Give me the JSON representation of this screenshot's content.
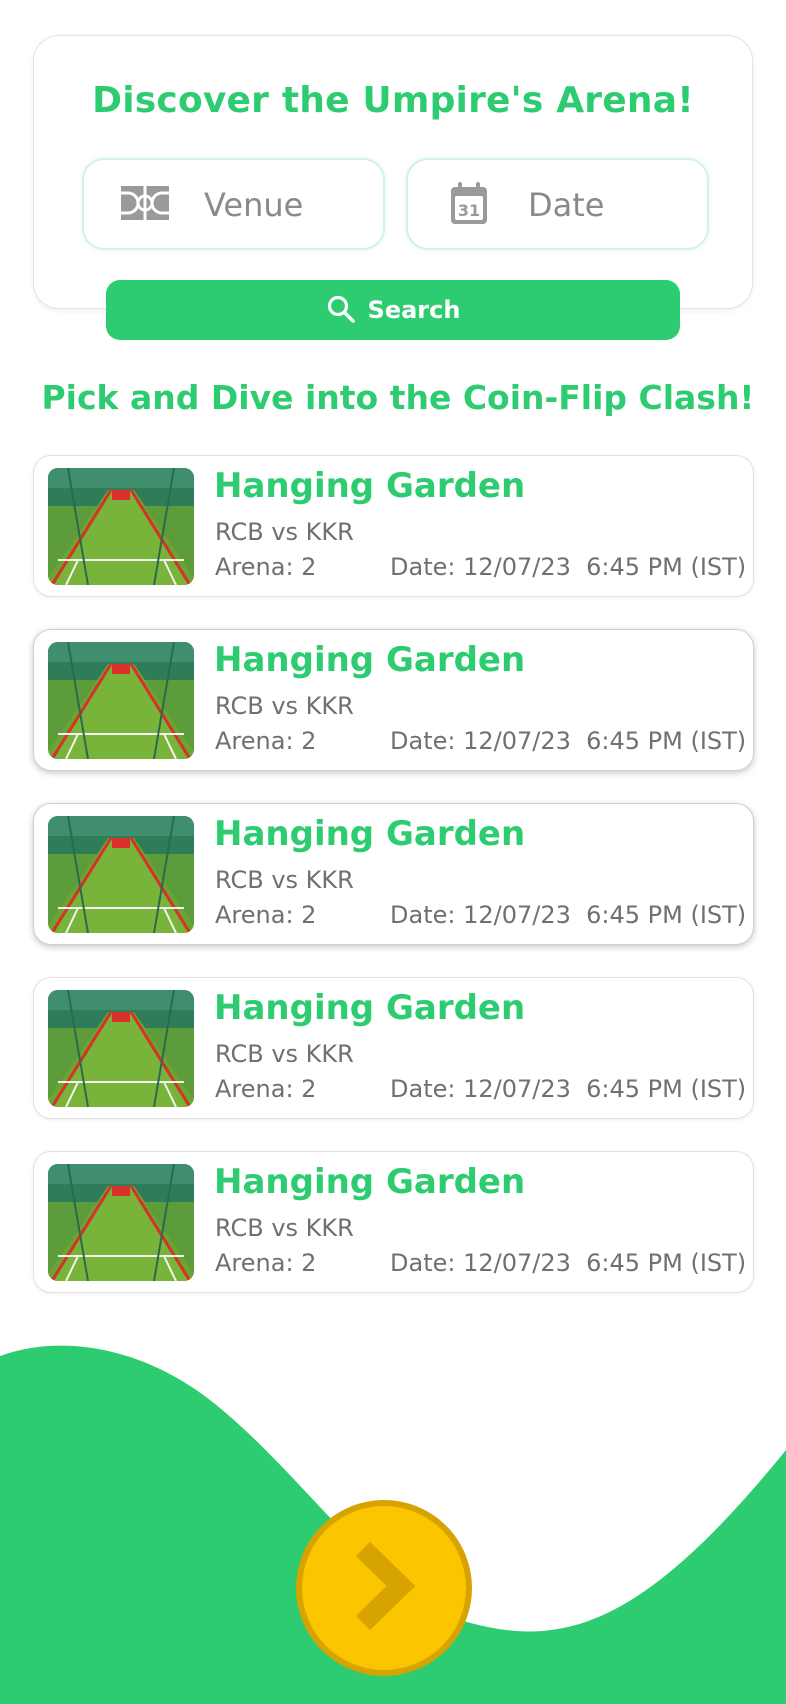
{
  "search": {
    "title": "Discover the Umpire's Arena!",
    "venue_placeholder": "Venue",
    "date_placeholder": "Date",
    "button_label": "Search"
  },
  "section": {
    "title": "Pick and Dive into the Coin-Flip Clash!"
  },
  "matches": [
    {
      "venue": "Hanging Garden",
      "teams": "RCB vs KKR",
      "arena": "Arena: 2",
      "datetime": "Date: 12/07/23  6:45 PM (IST)"
    },
    {
      "venue": "Hanging Garden",
      "teams": "RCB vs KKR",
      "arena": "Arena: 2",
      "datetime": "Date: 12/07/23  6:45 PM (IST)"
    },
    {
      "venue": "Hanging Garden",
      "teams": "RCB vs KKR",
      "arena": "Arena: 2",
      "datetime": "Date: 12/07/23  6:45 PM (IST)"
    },
    {
      "venue": "Hanging Garden",
      "teams": "RCB vs KKR",
      "arena": "Arena: 2",
      "datetime": "Date: 12/07/23  6:45 PM (IST)"
    },
    {
      "venue": "Hanging Garden",
      "teams": "RCB vs KKR",
      "arena": "Arena: 2",
      "datetime": "Date: 12/07/23  6:45 PM (IST)"
    }
  ],
  "icons": {
    "venue": "stadium-field-icon",
    "date": "calendar-icon",
    "search": "search-icon",
    "next": "chevron-right-icon"
  },
  "colors": {
    "accent": "#2ecc71",
    "fab": "#fbc500",
    "fab_border": "#d6a300",
    "text_muted": "#707070"
  }
}
